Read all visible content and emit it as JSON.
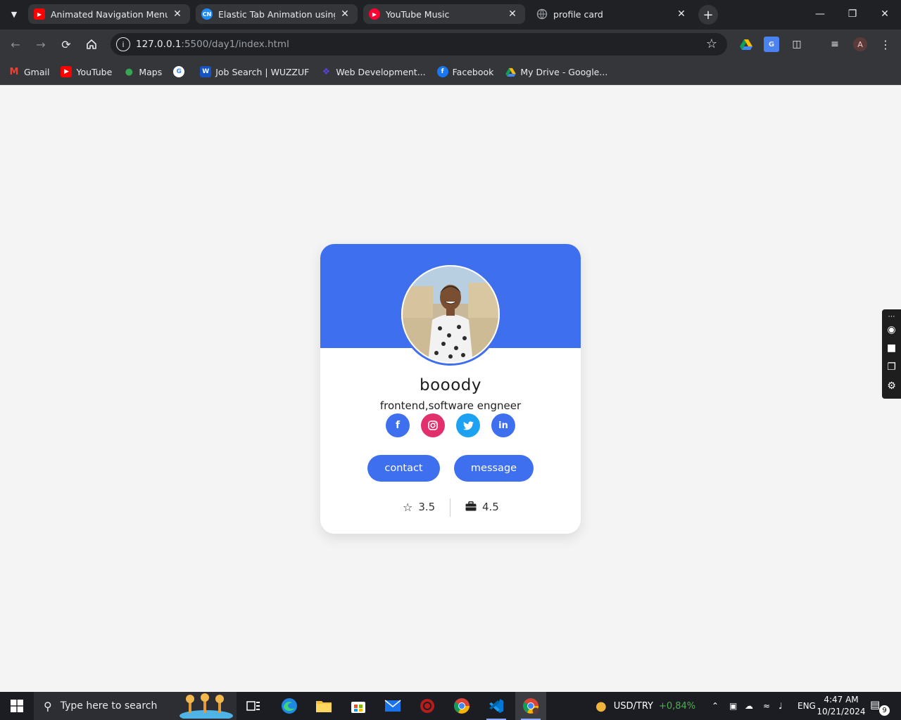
{
  "browser": {
    "tabs": [
      {
        "title": "Animated Navigation Menu Bar",
        "favicon": "youtube-icon"
      },
      {
        "title": "Elastic Tab Animation using HTML",
        "favicon": "codingnepal-icon"
      },
      {
        "title": "YouTube Music",
        "favicon": "youtube-music-icon"
      },
      {
        "title": "profile card",
        "favicon": "globe-icon",
        "active": true
      }
    ],
    "url_host": "127.0.0.1",
    "url_path": ":5500/day1/index.html",
    "profile_initial": "A",
    "bookmarks": [
      {
        "label": "Gmail",
        "icon": "gmail-icon"
      },
      {
        "label": "YouTube",
        "icon": "youtube-icon"
      },
      {
        "label": "Maps",
        "icon": "maps-icon"
      },
      {
        "label": "",
        "icon": "google-icon"
      },
      {
        "label": "Job Search | WUZZUF",
        "icon": "wuzzuf-icon"
      },
      {
        "label": "Web Development...",
        "icon": "web-dev-icon"
      },
      {
        "label": "Facebook",
        "icon": "facebook-icon"
      },
      {
        "label": "My Drive - Google...",
        "icon": "google-drive-icon"
      }
    ]
  },
  "card": {
    "name": "booody",
    "role": "frontend,software engneer",
    "socials": [
      {
        "network": "facebook",
        "icon": "facebook-icon",
        "color": "#3e6fef"
      },
      {
        "network": "instagram",
        "icon": "instagram-icon",
        "color": "#e1306c"
      },
      {
        "network": "twitter",
        "icon": "twitter-icon",
        "color": "#1da1f2"
      },
      {
        "network": "linkedin",
        "icon": "linkedin-icon",
        "color": "#3e6fef"
      }
    ],
    "buttons": {
      "contact": "contact",
      "message": "message"
    },
    "stats": [
      {
        "icon": "star-icon",
        "value": "3.5"
      },
      {
        "icon": "briefcase-icon",
        "value": "4.5"
      }
    ],
    "accent_color": "#3e6fef"
  },
  "taskbar": {
    "search_placeholder": "Type here to search",
    "ticker_label": "USD/TRY",
    "ticker_change": "+0,84%",
    "language": "ENG",
    "time": "4:47 AM",
    "date": "10/21/2024",
    "notification_count": "9"
  }
}
